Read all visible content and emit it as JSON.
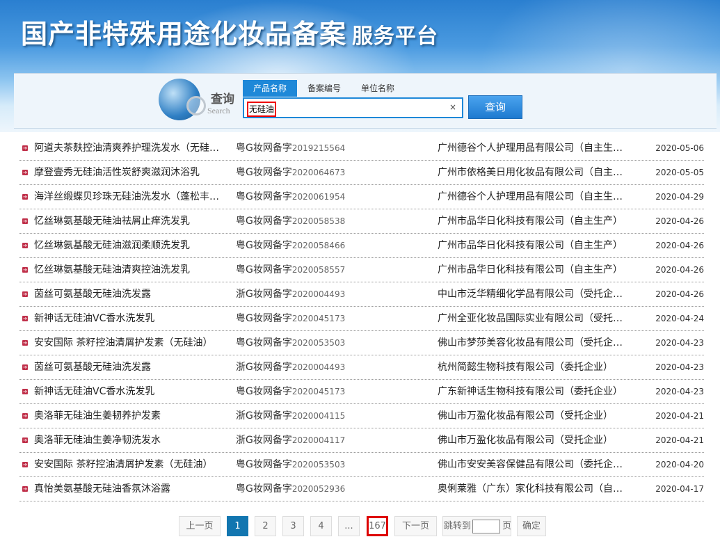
{
  "header": {
    "title": "国产非特殊用途化妆品备案",
    "subtitle": "服务平台"
  },
  "search": {
    "logo_text": "查询",
    "logo_sub": "Search",
    "tabs": [
      {
        "label": "产品名称",
        "active": true
      },
      {
        "label": "备案编号"
      },
      {
        "label": "单位名称"
      }
    ],
    "value": "无硅油",
    "clear": "×",
    "button": "查询"
  },
  "colors": {
    "accent": "#1e88d8",
    "page_active": "#1276b0",
    "bullet": "#c0304a",
    "highlight": "#dd0000"
  },
  "rows": [
    {
      "name": "阿道夫茶麸控油清爽养护理洗发水（无硅…",
      "reg_prefix": "粤G妆网备字",
      "reg_num": "2019215564",
      "company": "广州德谷个人护理用品有限公司（自主生…",
      "date": "2020-05-06"
    },
    {
      "name": "摩登壹秀无硅油活性炭舒爽滋润沐浴乳",
      "reg_prefix": "粤G妆网备字",
      "reg_num": "2020064673",
      "company": "广州市依格美日用化妆品有限公司（自主…",
      "date": "2020-05-05"
    },
    {
      "name": "海洋丝缎蝶贝珍珠无硅油洗发水（蓬松丰…",
      "reg_prefix": "粤G妆网备字",
      "reg_num": "2020061954",
      "company": "广州德谷个人护理用品有限公司（自主生…",
      "date": "2020-04-29"
    },
    {
      "name": "忆丝琳氨基酸无硅油祛屑止痒洗发乳",
      "reg_prefix": "粤G妆网备字",
      "reg_num": "2020058538",
      "company": "广州市品华日化科技有限公司（自主生产）",
      "date": "2020-04-26"
    },
    {
      "name": "忆丝琳氨基酸无硅油滋润柔顺洗发乳",
      "reg_prefix": "粤G妆网备字",
      "reg_num": "2020058466",
      "company": "广州市品华日化科技有限公司（自主生产）",
      "date": "2020-04-26"
    },
    {
      "name": "忆丝琳氨基酸无硅油清爽控油洗发乳",
      "reg_prefix": "粤G妆网备字",
      "reg_num": "2020058557",
      "company": "广州市品华日化科技有限公司（自主生产）",
      "date": "2020-04-26"
    },
    {
      "name": "茵丝可氨基酸无硅油洗发露",
      "reg_prefix": "浙G妆网备字",
      "reg_num": "2020004493",
      "company": "中山市泛华精细化学品有限公司（受托企…",
      "date": "2020-04-26"
    },
    {
      "name": "新神话无硅油VC香水洗发乳",
      "reg_prefix": "粤G妆网备字",
      "reg_num": "2020045173",
      "company": "广州全亚化妆品国际实业有限公司（受托…",
      "date": "2020-04-24"
    },
    {
      "name": "安安国际 茶籽控油清屑护发素（无硅油）",
      "reg_prefix": "粤G妆网备字",
      "reg_num": "2020053503",
      "company": "佛山市梦莎美容化妆品有限公司（受托企…",
      "date": "2020-04-23"
    },
    {
      "name": "茵丝可氨基酸无硅油洗发露",
      "reg_prefix": "浙G妆网备字",
      "reg_num": "2020004493",
      "company": "杭州简懿生物科技有限公司（委托企业）",
      "date": "2020-04-23"
    },
    {
      "name": "新神话无硅油VC香水洗发乳",
      "reg_prefix": "粤G妆网备字",
      "reg_num": "2020045173",
      "company": "广东新神话生物科技有限公司（委托企业）",
      "date": "2020-04-23"
    },
    {
      "name": "奥洛菲无硅油生姜韧养护发素",
      "reg_prefix": "浙G妆网备字",
      "reg_num": "2020004115",
      "company": "佛山市万盈化妆品有限公司（受托企业）",
      "date": "2020-04-21"
    },
    {
      "name": "奥洛菲无硅油生姜净韧洗发水",
      "reg_prefix": "浙G妆网备字",
      "reg_num": "2020004117",
      "company": "佛山市万盈化妆品有限公司（受托企业）",
      "date": "2020-04-21"
    },
    {
      "name": "安安国际 茶籽控油清屑护发素（无硅油）",
      "reg_prefix": "粤G妆网备字",
      "reg_num": "2020053503",
      "company": "佛山市安安美容保健品有限公司（委托企…",
      "date": "2020-04-20"
    },
    {
      "name": "真怡美氨基酸无硅油香氛沐浴露",
      "reg_prefix": "粤G妆网备字",
      "reg_num": "2020052936",
      "company": "奥俐莱雅（广东）家化科技有限公司（自…",
      "date": "2020-04-17"
    }
  ],
  "pagination": {
    "prev": "上一页",
    "pages": [
      "1",
      "2",
      "3",
      "4"
    ],
    "current": "1",
    "ellipsis": "...",
    "last": "167",
    "next": "下一页",
    "jump_label": "跳转到",
    "jump_value": "",
    "page_unit": "页",
    "confirm": "确定"
  }
}
